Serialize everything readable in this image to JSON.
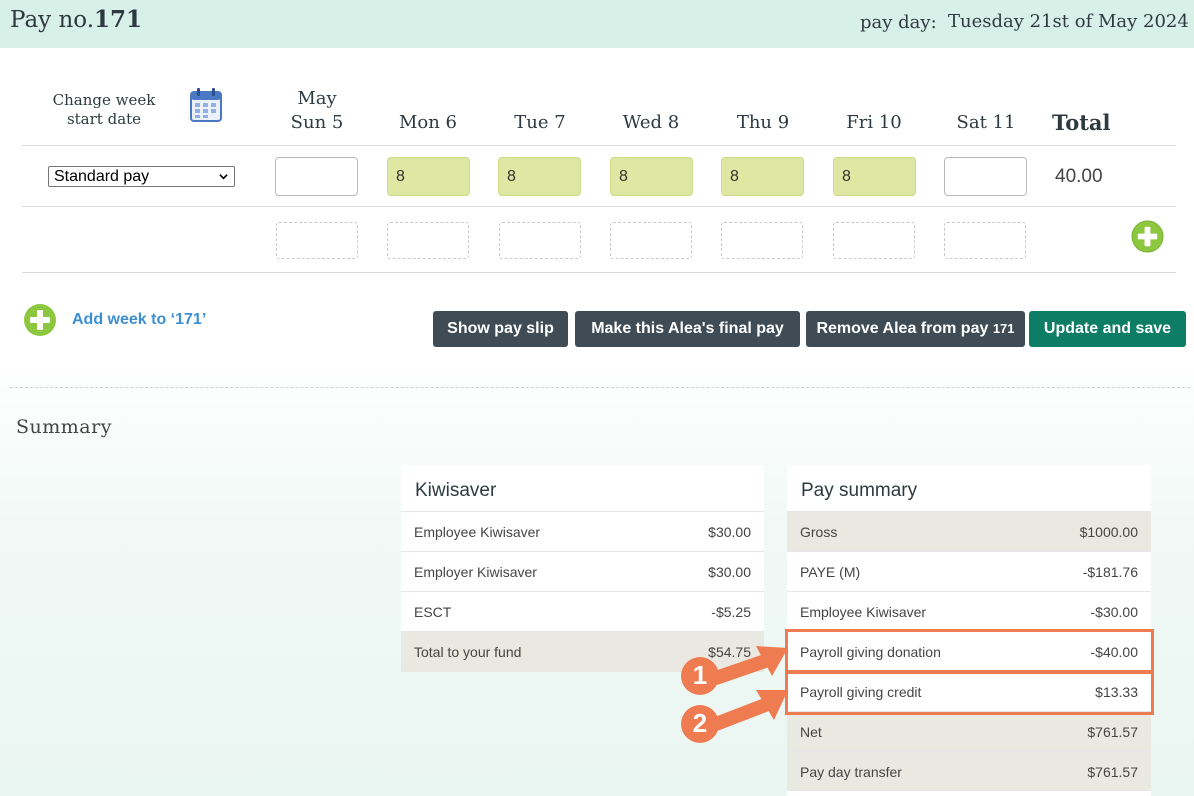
{
  "header": {
    "title_prefix": "Pay no.",
    "pay_number": "171",
    "payday_label": "pay day:",
    "payday_value": "Tuesday 21st of May 2024"
  },
  "week": {
    "change_week_label_line1": "Change week",
    "change_week_label_line2": "start date",
    "month_label": "May",
    "days": [
      "Sun 5",
      "Mon 6",
      "Tue 7",
      "Wed 8",
      "Thu 9",
      "Fri 10",
      "Sat 11"
    ],
    "total_label": "Total"
  },
  "pay_row": {
    "pay_type": "Standard pay",
    "hours": [
      "",
      "8",
      "8",
      "8",
      "8",
      "8",
      ""
    ],
    "total": "40.00"
  },
  "add_week_label": "Add week to ‘171’",
  "buttons": {
    "show_pay_slip": "Show pay slip",
    "final_pay": "Make this Alea's final pay",
    "remove_from_pay": "Remove Alea from pay",
    "remove_from_pay_number": "171",
    "update_save": "Update and save"
  },
  "summary_title": "Summary",
  "kiwisaver": {
    "title": "Kiwisaver",
    "rows": [
      {
        "label": "Employee Kiwisaver",
        "value": "$30.00"
      },
      {
        "label": "Employer Kiwisaver",
        "value": "$30.00"
      },
      {
        "label": "ESCT",
        "value": "-$5.25"
      },
      {
        "label": "Total to your fund",
        "value": "$54.75"
      }
    ]
  },
  "pay_summary": {
    "title": "Pay summary",
    "rows": [
      {
        "label": "Gross",
        "value": "$1000.00"
      },
      {
        "label": "PAYE (M)",
        "value": "-$181.76"
      },
      {
        "label": "Employee Kiwisaver",
        "value": "-$30.00"
      },
      {
        "label": "Payroll giving donation",
        "value": "-$40.00"
      },
      {
        "label": "Payroll giving credit",
        "value": "$13.33"
      },
      {
        "label": "Net",
        "value": "$761.57"
      },
      {
        "label": "Pay day transfer",
        "value": "$761.57"
      }
    ]
  },
  "callouts": [
    "1",
    "2"
  ],
  "colors": {
    "header_bg": "#d7f0e8",
    "hours_filled": "#dfe8a2",
    "button_dark": "#3f4c55",
    "button_green": "#0e7d66",
    "link_blue": "#3d8fd1",
    "plus_green": "#8dc63f",
    "highlight": "#ef7b50"
  }
}
